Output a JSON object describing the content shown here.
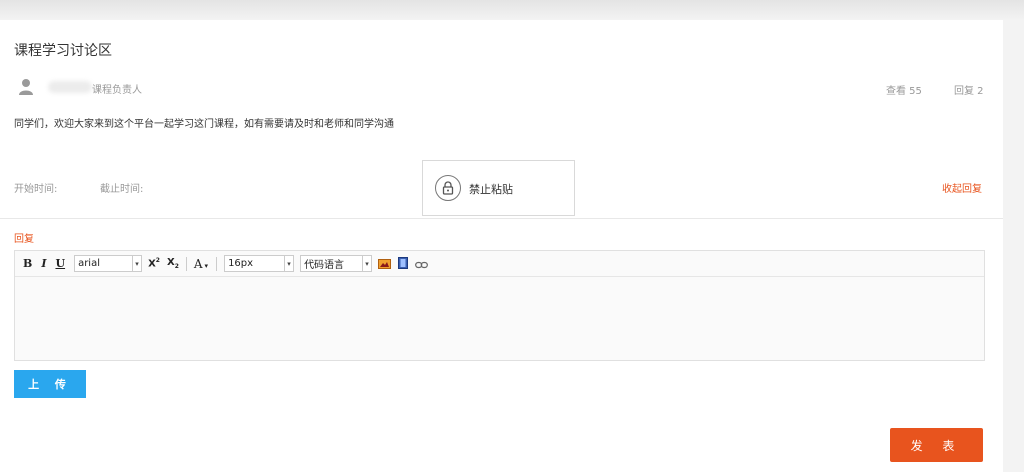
{
  "topic": {
    "title": "课程学习讨论区",
    "author_role": "课程负责人",
    "views_label": "查看 55",
    "replies_label": "回复 2",
    "content": "同学们，欢迎大家来到这个平台一起学习这门课程，如有需要请及时和老师和同学沟通",
    "start_time_label": "开始时间:",
    "end_time_label": "截止时间:",
    "collapse_label": "收起回复"
  },
  "paste_notice": {
    "label": "禁止粘贴",
    "icon": "lock-icon"
  },
  "reply": {
    "label": "回复",
    "upload_label": "上 传",
    "submit_label": "发 表"
  },
  "toolbar": {
    "bold": "B",
    "italic": "I",
    "underline": "U",
    "font_family": "arial",
    "superscript": "X²",
    "subscript": "X₂",
    "font_color": "A",
    "font_size": "16px",
    "code_language": "代码语言",
    "icons": [
      "image-icon",
      "video-icon",
      "link-icon"
    ]
  },
  "colors": {
    "accent": "#e8541e",
    "upload": "#2aa7ee",
    "muted": "#999999"
  }
}
